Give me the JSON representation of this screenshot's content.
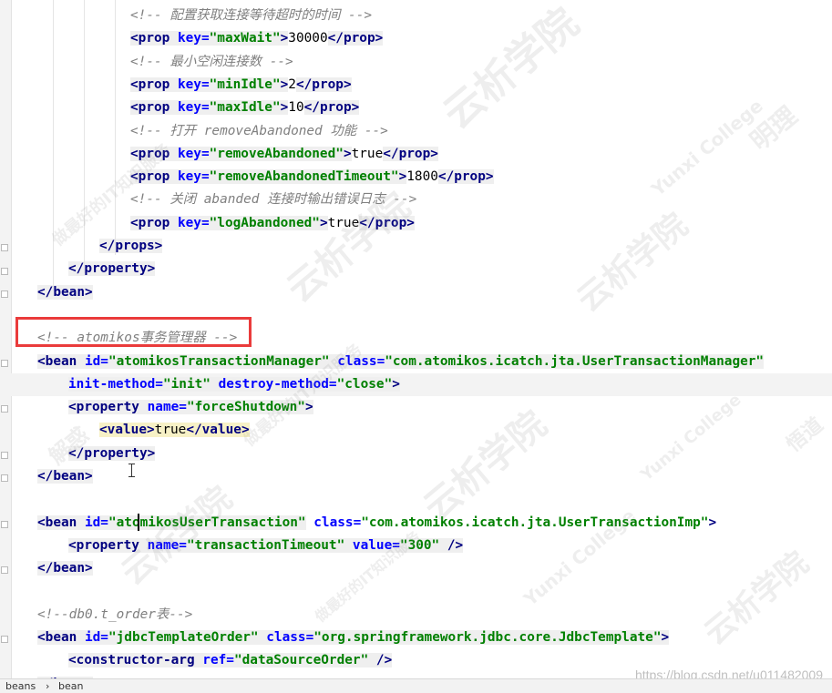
{
  "lines": [
    {
      "segments": [
        {
          "t": "c",
          "s": "<!-- 配置获取连接等待超时的时间 -->"
        }
      ]
    },
    {
      "segments": [
        {
          "t": "t",
          "s": "<prop ",
          "bg": "tagbg"
        },
        {
          "t": "a",
          "s": "key=",
          "bg": "tagbg"
        },
        {
          "t": "v",
          "s": "\"maxWait\"",
          "bg": "tagbg"
        },
        {
          "t": "t",
          "s": ">",
          "bg": "tagbg"
        },
        {
          "t": "x",
          "s": "30000"
        },
        {
          "t": "t",
          "s": "</prop>",
          "bg": "tagbg"
        }
      ]
    },
    {
      "segments": [
        {
          "t": "c",
          "s": "<!-- 最小空闲连接数 -->"
        }
      ]
    },
    {
      "segments": [
        {
          "t": "t",
          "s": "<prop ",
          "bg": "tagbg"
        },
        {
          "t": "a",
          "s": "key=",
          "bg": "tagbg"
        },
        {
          "t": "v",
          "s": "\"minIdle\"",
          "bg": "tagbg"
        },
        {
          "t": "t",
          "s": ">",
          "bg": "tagbg"
        },
        {
          "t": "x",
          "s": "2"
        },
        {
          "t": "t",
          "s": "</prop>",
          "bg": "tagbg"
        }
      ]
    },
    {
      "segments": [
        {
          "t": "t",
          "s": "<prop ",
          "bg": "tagbg"
        },
        {
          "t": "a",
          "s": "key=",
          "bg": "tagbg"
        },
        {
          "t": "v",
          "s": "\"maxIdle\"",
          "bg": "tagbg"
        },
        {
          "t": "t",
          "s": ">",
          "bg": "tagbg"
        },
        {
          "t": "x",
          "s": "10"
        },
        {
          "t": "t",
          "s": "</prop>",
          "bg": "tagbg"
        }
      ]
    },
    {
      "segments": [
        {
          "t": "c",
          "s": "<!-- 打开 removeAbandoned 功能 -->"
        }
      ]
    },
    {
      "segments": [
        {
          "t": "t",
          "s": "<prop ",
          "bg": "tagbg"
        },
        {
          "t": "a",
          "s": "key=",
          "bg": "tagbg"
        },
        {
          "t": "v",
          "s": "\"removeAbandoned\"",
          "bg": "tagbg"
        },
        {
          "t": "t",
          "s": ">",
          "bg": "tagbg"
        },
        {
          "t": "x",
          "s": "true"
        },
        {
          "t": "t",
          "s": "</prop>",
          "bg": "tagbg"
        }
      ]
    },
    {
      "segments": [
        {
          "t": "t",
          "s": "<prop ",
          "bg": "tagbg"
        },
        {
          "t": "a",
          "s": "key=",
          "bg": "tagbg"
        },
        {
          "t": "v",
          "s": "\"removeAbandonedTimeout\"",
          "bg": "tagbg"
        },
        {
          "t": "t",
          "s": ">",
          "bg": "tagbg"
        },
        {
          "t": "x",
          "s": "1800"
        },
        {
          "t": "t",
          "s": "</prop>",
          "bg": "tagbg"
        }
      ]
    },
    {
      "segments": [
        {
          "t": "c",
          "s": "<!-- 关闭 abanded 连接时输出错误日志 -->"
        }
      ]
    },
    {
      "segments": [
        {
          "t": "t",
          "s": "<prop ",
          "bg": "tagbg"
        },
        {
          "t": "a",
          "s": "key=",
          "bg": "tagbg"
        },
        {
          "t": "v",
          "s": "\"logAbandoned\"",
          "bg": "tagbg"
        },
        {
          "t": "t",
          "s": ">",
          "bg": "tagbg"
        },
        {
          "t": "x",
          "s": "true"
        },
        {
          "t": "t",
          "s": "</prop>",
          "bg": "tagbg"
        }
      ]
    },
    {
      "segments": [
        {
          "t": "t",
          "s": "</props>",
          "bg": "tagbg"
        }
      ]
    },
    {
      "segments": [
        {
          "t": "t",
          "s": "</property>",
          "bg": "tagbg"
        }
      ]
    },
    {
      "segments": [
        {
          "t": "t",
          "s": "</bean>",
          "bg": "tagbg"
        }
      ]
    },
    {
      "segments": []
    },
    {
      "segments": [
        {
          "t": "c",
          "s": "<!-- atomikos事务管理器 -->"
        }
      ]
    },
    {
      "segments": [
        {
          "t": "t",
          "s": "<bean ",
          "bg": "tagbg"
        },
        {
          "t": "a",
          "s": "id=",
          "bg": "tagbg"
        },
        {
          "t": "v",
          "s": "\"atomikosTransactionManager\"",
          "bg": "tagbg"
        },
        {
          "t": "x",
          "s": " ",
          "bg": "tagbg"
        },
        {
          "t": "a",
          "s": "class=",
          "bg": "tagbg"
        },
        {
          "t": "v",
          "s": "\"com.atomikos.icatch.jta.UserTransactionManager\"",
          "bg": "tagbg"
        }
      ]
    },
    {
      "segments": [
        {
          "t": "a",
          "s": "init-method=",
          "bg": "tagbg"
        },
        {
          "t": "v",
          "s": "\"init\"",
          "bg": "tagbg"
        },
        {
          "t": "x",
          "s": " ",
          "bg": "tagbg"
        },
        {
          "t": "a",
          "s": "destroy-method=",
          "bg": "tagbg"
        },
        {
          "t": "v",
          "s": "\"close\"",
          "bg": "tagbg"
        },
        {
          "t": "t",
          "s": ">",
          "bg": "tagbg"
        }
      ]
    },
    {
      "segments": [
        {
          "t": "t",
          "s": "<property ",
          "bg": "tagbg"
        },
        {
          "t": "a",
          "s": "name=",
          "bg": "tagbg"
        },
        {
          "t": "v",
          "s": "\"forceShutdown\"",
          "bg": "tagbg"
        },
        {
          "t": "t",
          "s": ">",
          "bg": "tagbg"
        }
      ]
    },
    {
      "segments": [
        {
          "t": "t",
          "s": "<value>",
          "bg": "matchbg"
        },
        {
          "t": "x",
          "s": "true",
          "bg": "matchbg"
        },
        {
          "t": "t",
          "s": "</value>",
          "bg": "matchbg"
        }
      ]
    },
    {
      "segments": [
        {
          "t": "t",
          "s": "</property>",
          "bg": "tagbg"
        }
      ]
    },
    {
      "segments": [
        {
          "t": "t",
          "s": "</bean>",
          "bg": "tagbg"
        }
      ]
    },
    {
      "segments": []
    },
    {
      "segments": [
        {
          "t": "t",
          "s": "<bean ",
          "bg": "tagbg"
        },
        {
          "t": "a",
          "s": "id=",
          "bg": "tagbg"
        },
        {
          "t": "v",
          "s": "\"atomikosUserTransaction\"",
          "bg": "tagbg"
        },
        {
          "t": "x",
          "s": " "
        },
        {
          "t": "a",
          "s": "class="
        },
        {
          "t": "v",
          "s": "\"com.atomikos.icatch.jta.UserTransactionImp\""
        },
        {
          "t": "t",
          "s": ">"
        }
      ]
    },
    {
      "segments": [
        {
          "t": "t",
          "s": "<property ",
          "bg": "tagbg"
        },
        {
          "t": "a",
          "s": "name=",
          "bg": "tagbg"
        },
        {
          "t": "v",
          "s": "\"transactionTimeout\"",
          "bg": "tagbg"
        },
        {
          "t": "x",
          "s": " ",
          "bg": "tagbg"
        },
        {
          "t": "a",
          "s": "value=",
          "bg": "tagbg"
        },
        {
          "t": "v",
          "s": "\"300\"",
          "bg": "tagbg"
        },
        {
          "t": "t",
          "s": " />",
          "bg": "tagbg"
        }
      ]
    },
    {
      "segments": [
        {
          "t": "t",
          "s": "</bean>",
          "bg": "tagbg"
        }
      ]
    },
    {
      "segments": []
    },
    {
      "segments": [
        {
          "t": "c",
          "s": "<!--db0.t_order表-->"
        }
      ]
    },
    {
      "segments": [
        {
          "t": "t",
          "s": "<bean ",
          "bg": "tagbg"
        },
        {
          "t": "a",
          "s": "id=",
          "bg": "tagbg"
        },
        {
          "t": "v",
          "s": "\"jdbcTemplateOrder\"",
          "bg": "tagbg"
        },
        {
          "t": "x",
          "s": " ",
          "bg": "tagbg"
        },
        {
          "t": "a",
          "s": "class=",
          "bg": "tagbg"
        },
        {
          "t": "v",
          "s": "\"org.springframework.jdbc.core.JdbcTemplate\"",
          "bg": "tagbg"
        },
        {
          "t": "t",
          "s": ">",
          "bg": "tagbg"
        }
      ]
    },
    {
      "segments": [
        {
          "t": "t",
          "s": "<constructor-arg ",
          "bg": "tagbg"
        },
        {
          "t": "a",
          "s": "ref=",
          "bg": "tagbg"
        },
        {
          "t": "v",
          "s": "\"dataSourceOrder\"",
          "bg": "tagbg"
        },
        {
          "t": "t",
          "s": " />",
          "bg": "tagbg"
        }
      ]
    },
    {
      "segments": [
        {
          "t": "t",
          "s": "</bean>",
          "bg": "tagbg"
        }
      ]
    }
  ],
  "breadcrumb": {
    "items": [
      "beans",
      "bean"
    ],
    "separator": "›"
  },
  "watermark": {
    "url": "https://blog.csdn.net/u011482009",
    "phrases": [
      "云析学院",
      "Yunxi College",
      "做最好的IT知识服务",
      "明理",
      "解惑",
      "悟道"
    ]
  },
  "colors": {
    "tag": "#000080",
    "attribute": "#0000ff",
    "value": "#008000",
    "comment": "#808080",
    "annotation_box": "#ea3b3b"
  }
}
